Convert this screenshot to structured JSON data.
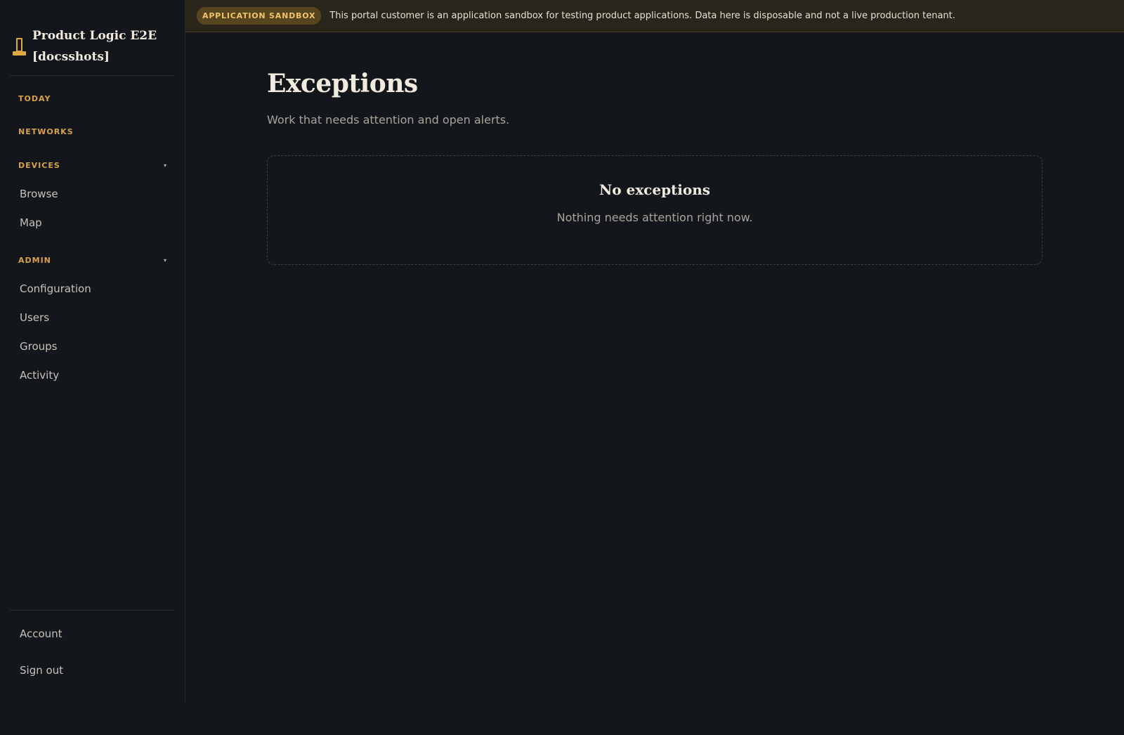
{
  "banner": {
    "badge": "APPLICATION SANDBOX",
    "message": "This portal customer is an application sandbox for testing product applications. Data here is disposable and not a live production tenant."
  },
  "sidebar": {
    "brand": "Product Logic E2E [docsshots]",
    "sections": {
      "today": "TODAY",
      "networks": "NETWORKS",
      "devices": "DEVICES",
      "admin": "ADMIN"
    },
    "devices_items": [
      "Browse",
      "Map"
    ],
    "admin_items": [
      "Configuration",
      "Users",
      "Groups",
      "Activity"
    ],
    "footer_items": [
      "Account",
      "Sign out"
    ],
    "caret": "▾"
  },
  "main": {
    "title": "Exceptions",
    "subtitle": "Work that needs attention and open alerts.",
    "empty_title": "No exceptions",
    "empty_text": "Nothing needs attention right now."
  },
  "colors": {
    "accent": "#e0a944",
    "background": "#13171c",
    "banner_bg": "#2a251a"
  }
}
